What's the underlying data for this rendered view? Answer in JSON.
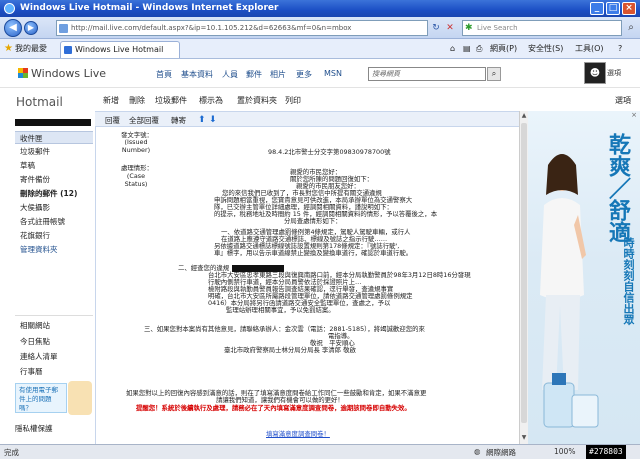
{
  "window": {
    "title": "Windows Live Hotmail - Windows Internet Explorer"
  },
  "address_bar": {
    "url": "http://mail.live.com/default.aspx?&ip=10.1.105.212&d=62663&mf=0&n=mbox",
    "search_placeholder": "Live Search"
  },
  "tab_bar": {
    "favorites_label": "我的最愛",
    "tab_title": "Windows Live Hotmail",
    "tools": [
      "網頁(P)",
      "安全性(S)",
      "工具(O)"
    ]
  },
  "hm_header": {
    "logo": "Windows Live",
    "nav": [
      "首頁",
      "基本資料",
      "人員",
      "郵件",
      "相片",
      "更多",
      "MSN"
    ],
    "search_placeholder": "搜尋網頁",
    "user_menu": "選項"
  },
  "sidebar": {
    "title": "Hotmail",
    "folders": [
      {
        "label": "收件匣"
      },
      {
        "label": "垃圾郵件"
      },
      {
        "label": "草稿"
      },
      {
        "label": "寄件備份"
      },
      {
        "label": "刪除的郵件 (12)"
      },
      {
        "label": "大侯攝影"
      },
      {
        "label": "各式註冊帳號"
      },
      {
        "label": "花旗銀行"
      },
      {
        "label": "管理資料夾"
      }
    ],
    "related": [
      "相關網站",
      "今日焦點",
      "連絡人清單",
      "行事曆"
    ],
    "ad_text": "有使用電子郵件上的問題嗎？",
    "hide_label": "隱私權保護"
  },
  "toolbar": {
    "items": [
      "新增",
      "刪除",
      "垃圾郵件",
      "標示為",
      "置於資料夾",
      "列印",
      "選項"
    ]
  },
  "read_toolbar": {
    "items": [
      "回覆",
      "全部回覆",
      "轉寄"
    ]
  },
  "email": {
    "meta_label_1": "發文字號：",
    "meta_value_1": "(Issued Number)",
    "meta_label_2": "處理情形：",
    "meta_value_2": "(Case Status)",
    "doc_number": "98.4.2北市警士分交字第09830978700號",
    "body_lines": [
      "親愛的市民您好：",
      "關於您所陳的問題回復如下：",
      "親愛的市民朋友您好：",
      "您的來信我們已收到了，市長對您信中所提有關交通違規",
      "申訴問題相當重視，您寶貴意見可供改進，本局承辦單位為交通警察大",
      "隊，已交辦主管單位詳細處理，經調閱相關資料，謹說明如下：",
      "的提示，稅務地址及時間約 15 件，經調閱相關資料的情形，予以答覆後之，本",
      "分局查處情形如下：",
      "一、依道路交通管理處罰條例第4條規定，駕駛人駕駛車輛，或行人",
      "在道路上應遵守道路交通標誌、標線及號誌之指示行駛……",
      "另依據道路交通標誌標線號誌設置規則第178條規定：『號誌行駛',",
      "車』標字，用以告示車道線禁止變換及變換車道行，確認於車道行駛。"
    ],
    "body_lines_2": [
      "二、經查您的違規",
      "台北市大安區忠孝東路三段與復興南路口前，經本分局執勤警員於98年3月12日8時16分發現",
      "行駛內側禁行車道，經本分局員警依法於採證照片上…",
      "檢附路段與執勤員警員報告調查結果確認，逕行舉發，查違規事實",
      "明確，台北市大安區所屬路段管理單位，請依道路交通管理處罰條例規定",
      "0416）本分局將另行函請道路交通安全監理單位，查處之，予以",
      "監理站辦理相關事宜，予以免罰結案。"
    ],
    "body_lines_3": [
      "三、如果您對本案尚有其他意見，請聯絡承辦人：金次雲（電話：2881-5185），將竭誠歡迎您的來",
      "電指導。",
      "敬祝　平安順心",
      "臺北市政府警察局士林分局分局長 李清郎 敬啟"
    ],
    "footer_1": "如果您對以上的回復內容感到滿意的話，則在了填寫滿意度問卷給工作同仁一些鼓勵和肯定，如果不滿意更",
    "footer_2": "請讓我們知道，讓我們有機會可以做的更好！",
    "footer_warning": "提醒您！系統於後續執行及處理，請務必在了天內填寫滿意度調查問卷，逾期該問卷即自動失效。",
    "survey_link": "填寫滿意度調查問卷！"
  },
  "ad_panel": {
    "headline": "乾爽／舒適",
    "sub": "時時刻刻自信出眾"
  },
  "status_bar": {
    "left": "完成",
    "zone": "網際網路",
    "zoom": "100%",
    "watermark": "#278803"
  }
}
